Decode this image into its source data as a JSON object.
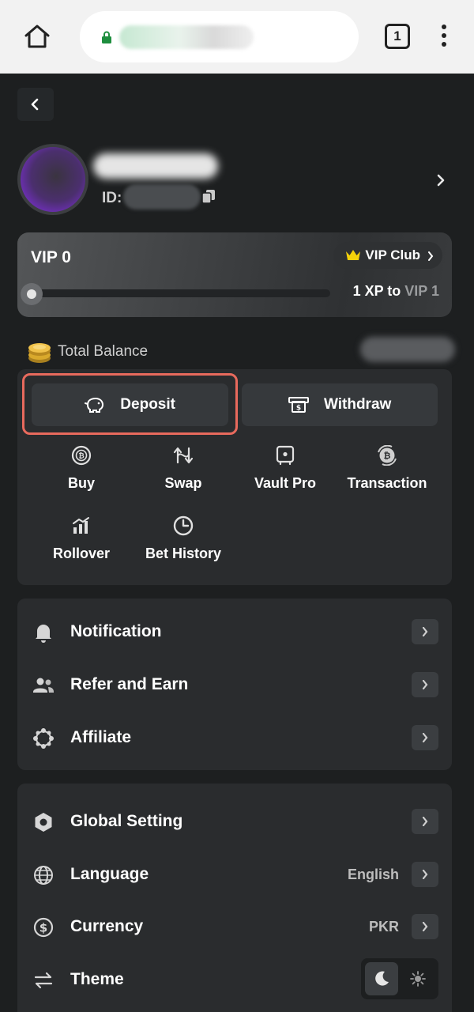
{
  "browser": {
    "tab_count": "1"
  },
  "profile": {
    "id_label": "ID:"
  },
  "vip": {
    "level": "VIP 0",
    "club_label": "VIP Club",
    "xp_text": "1 XP to",
    "next_level": "VIP 1",
    "progress": 0
  },
  "balance": {
    "label": "Total Balance"
  },
  "wallet": {
    "deposit_label": "Deposit",
    "withdraw_label": "Withdraw",
    "actions": [
      {
        "label": "Buy",
        "icon": "bitcoin-coin-icon"
      },
      {
        "label": "Swap",
        "icon": "swap-icon"
      },
      {
        "label": "Vault Pro",
        "icon": "vault-icon"
      },
      {
        "label": "Transaction",
        "icon": "transaction-icon"
      },
      {
        "label": "Rollover",
        "icon": "rollover-chart-icon"
      },
      {
        "label": "Bet History",
        "icon": "clock-icon"
      }
    ]
  },
  "menu_primary": [
    {
      "label": "Notification",
      "icon": "bell-icon"
    },
    {
      "label": "Refer and Earn",
      "icon": "users-icon"
    },
    {
      "label": "Affiliate",
      "icon": "affiliate-icon"
    }
  ],
  "menu_settings": [
    {
      "label": "Global Setting",
      "icon": "gear-hex-icon",
      "value": ""
    },
    {
      "label": "Language",
      "icon": "globe-icon",
      "value": "English"
    },
    {
      "label": "Currency",
      "icon": "dollar-circle-icon",
      "value": "PKR"
    },
    {
      "label": "Theme",
      "icon": "swap-arrows-icon",
      "value": ""
    }
  ],
  "colors": {
    "background": "#1d1f20",
    "panel": "#2a2c2e",
    "button": "#36393c",
    "highlight": "#e86a5d",
    "crown": "#f5d20a"
  }
}
